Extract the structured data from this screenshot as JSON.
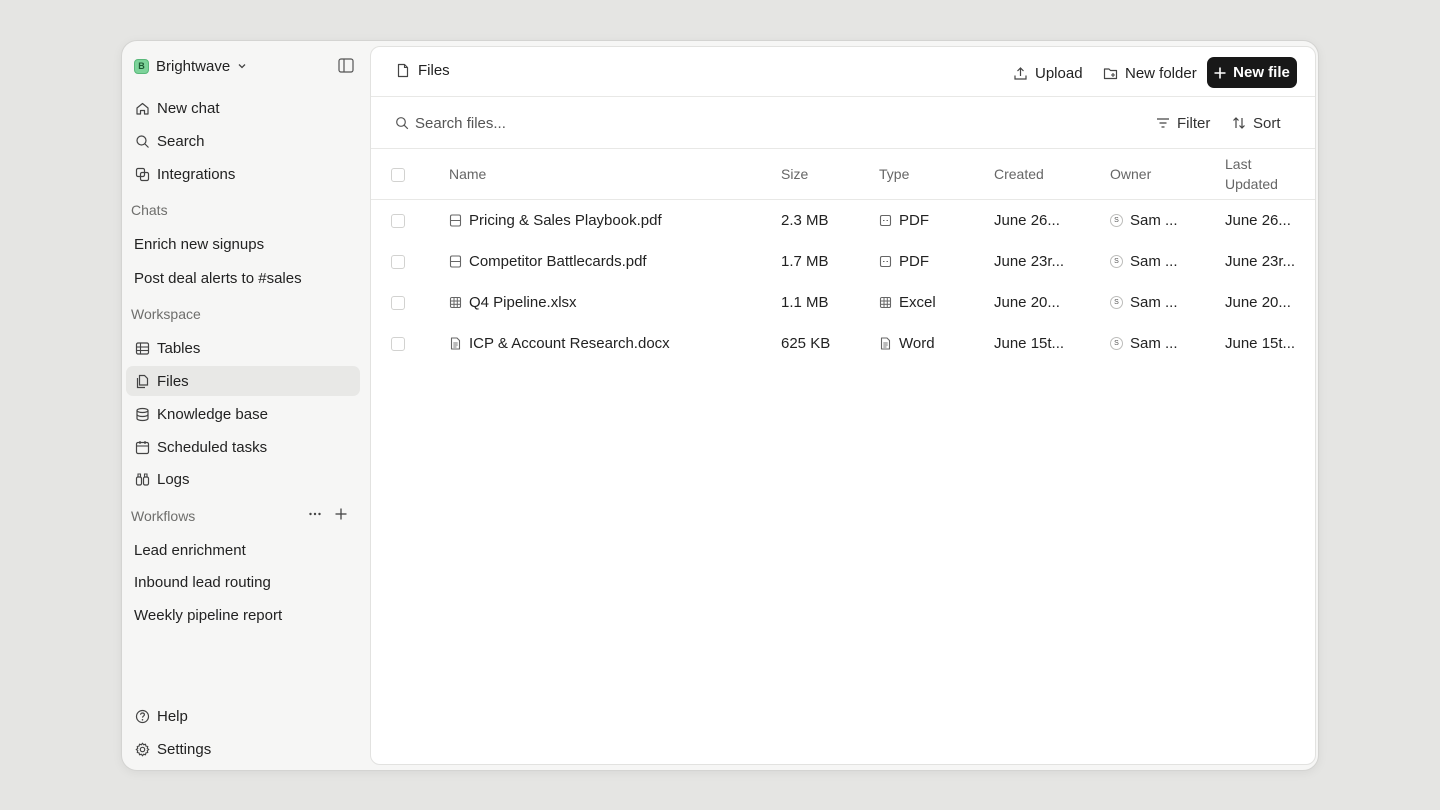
{
  "workspace": {
    "name": "Brightwave",
    "logo_letter": "B"
  },
  "nav": {
    "new_chat": "New chat",
    "search": "Search",
    "integrations": "Integrations"
  },
  "chats": {
    "label": "Chats",
    "items": [
      "Enrich new signups",
      "Post deal alerts to #sales"
    ]
  },
  "workspace_section": {
    "label": "Workspace",
    "items": {
      "tables": "Tables",
      "files": "Files",
      "knowledge_base": "Knowledge base",
      "scheduled_tasks": "Scheduled tasks",
      "logs": "Logs"
    }
  },
  "workflows": {
    "label": "Workflows",
    "items": [
      "Lead enrichment",
      "Inbound lead routing",
      "Weekly pipeline report"
    ]
  },
  "footer": {
    "help": "Help",
    "settings": "Settings"
  },
  "header": {
    "title": "Files",
    "upload": "Upload",
    "new_folder": "New folder",
    "new_file": "New file"
  },
  "search": {
    "placeholder": "Search files..."
  },
  "toolbar": {
    "filter": "Filter",
    "sort": "Sort"
  },
  "table": {
    "columns": {
      "name": "Name",
      "size": "Size",
      "type": "Type",
      "created": "Created",
      "owner": "Owner",
      "last_updated_1": "Last",
      "last_updated_2": "Updated"
    },
    "rows": [
      {
        "name": "Pricing & Sales Playbook.pdf",
        "size": "2.3 MB",
        "type": "PDF",
        "type_icon": "pdf-icon",
        "created": "June 26...",
        "owner_initial": "S",
        "owner": "Sam ...",
        "updated": "June 26..."
      },
      {
        "name": "Competitor Battlecards.pdf",
        "size": "1.7 MB",
        "type": "PDF",
        "type_icon": "pdf-icon",
        "created": "June 23r...",
        "owner_initial": "S",
        "owner": "Sam ...",
        "updated": "June 23r..."
      },
      {
        "name": "Q4 Pipeline.xlsx",
        "size": "1.1 MB",
        "type": "Excel",
        "type_icon": "spreadsheet-icon",
        "created": "June 20...",
        "owner_initial": "S",
        "owner": "Sam ...",
        "updated": "June 20..."
      },
      {
        "name": "ICP & Account Research.docx",
        "size": "625 KB",
        "type": "Word",
        "type_icon": "document-icon",
        "created": "June 15t...",
        "owner_initial": "S",
        "owner": "Sam ...",
        "updated": "June 15t..."
      }
    ]
  }
}
